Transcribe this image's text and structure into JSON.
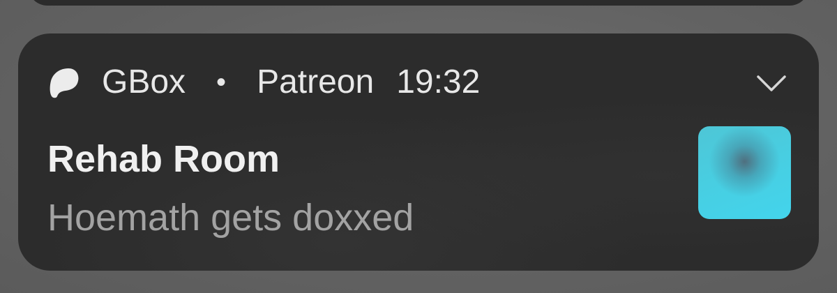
{
  "notification": {
    "app_icon": "patreon-icon",
    "app_name": "GBox",
    "separator": "•",
    "source": "Patreon",
    "time": "19:32",
    "expand_icon": "chevron-down-icon",
    "title": "Rehab Room",
    "body": "Hoemath gets doxxed",
    "thumbnail": "blurred-thumbnail"
  },
  "colors": {
    "card_background": "#2c2c2c",
    "title_text": "#f0f0f0",
    "body_text": "#a3a3a3",
    "thumbnail_accent": "#47cfe3"
  }
}
